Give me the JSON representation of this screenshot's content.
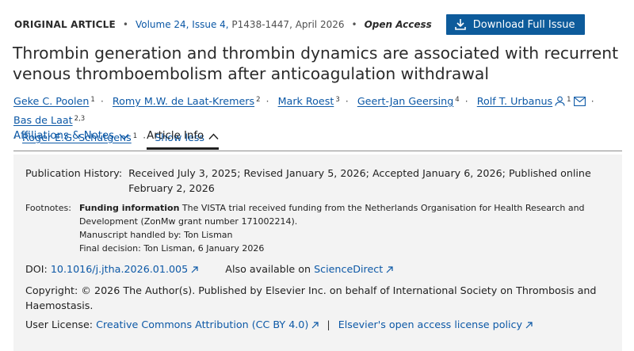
{
  "meta": {
    "article_type": "ORIGINAL ARTICLE",
    "volume_link": "Volume 24, Issue 4,",
    "pages_date": "P1438-1447, April 2026",
    "access": "Open Access",
    "download_label": "Download Full Issue"
  },
  "title": "Thrombin generation and thrombin dynamics are associated with recurrent venous thromboembolism after anticoagulation withdrawal",
  "authors": [
    {
      "name": "Geke C. Poolen",
      "aff": "1"
    },
    {
      "name": "Romy M.W. de Laat-Kremers",
      "aff": "2"
    },
    {
      "name": "Mark Roest",
      "aff": "3"
    },
    {
      "name": "Geert-Jan Geersing",
      "aff": "4"
    },
    {
      "name": "Rolf T. Urbanus",
      "aff": "1"
    },
    {
      "name": "Bas de Laat",
      "aff": "2,3"
    },
    {
      "name": "Roger E.G. Schutgens",
      "aff": "1"
    }
  ],
  "show_less": "Show less",
  "tabs": {
    "affiliations": "Affiliations & Notes",
    "article_info": "Article Info"
  },
  "info": {
    "pub_label": "Publication History:",
    "pub_value": "Received July 3, 2025; Revised January 5, 2026; Accepted January 6, 2026; Published online February 2, 2026",
    "footnotes_label": "Footnotes:",
    "funding_label": "Funding information",
    "funding_text": "The VISTA trial received funding from the Netherlands Organisation for Health Research and Development (ZonMw grant number 171002214).",
    "handled": "Manuscript handled by: Ton Lisman",
    "final": "Final decision: Ton Lisman, 6 January 2026",
    "doi_label": "DOI:",
    "doi_value": "10.1016/j.jtha.2026.01.005",
    "also_label": "Also available on",
    "also_link": "ScienceDirect",
    "copyright": "Copyright: © 2026 The Author(s). Published by Elsevier Inc. on behalf of International Society on Thrombosis and Haemostasis.",
    "license_label": "User License:",
    "license_link": "Creative Commons Attribution (CC BY 4.0)",
    "policy_link": "Elsevier's open access license policy"
  }
}
